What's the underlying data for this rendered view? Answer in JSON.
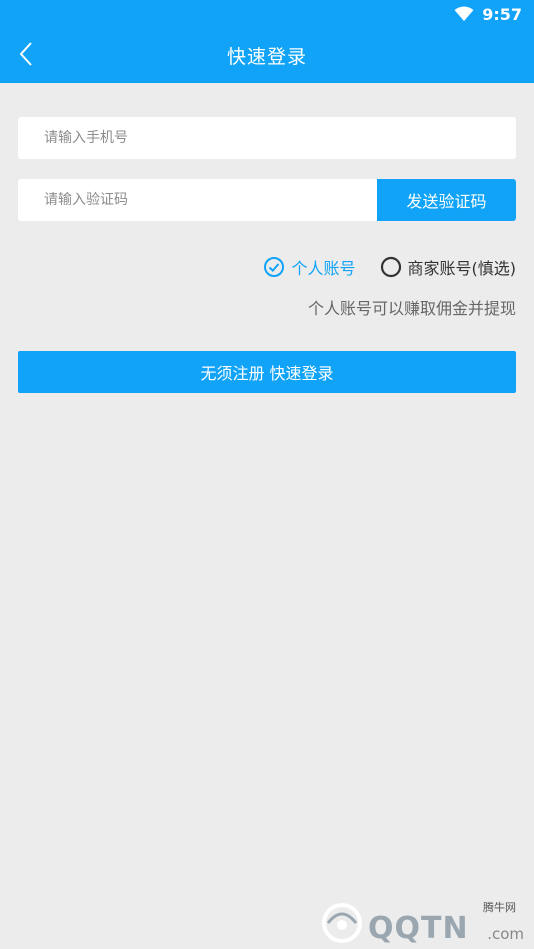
{
  "status_bar": {
    "time": "9:57",
    "wifi_icon": "wifi-icon"
  },
  "header": {
    "title": "快速登录",
    "back_icon": "chevron-left-icon"
  },
  "form": {
    "phone_placeholder": "请输入手机号",
    "code_placeholder": "请输入验证码",
    "send_code_label": "发送验证码"
  },
  "account_type": {
    "personal_label": "个人账号",
    "merchant_label": "商家账号(慎选)",
    "selected": "personal"
  },
  "hint": "个人账号可以赚取佣金并提现",
  "login_button": "无须注册 快速登录",
  "watermark": {
    "text": "QQTN",
    "suffix": ".com",
    "site": "腾牛网"
  },
  "colors": {
    "accent": "#10a3f7",
    "background": "#ececec"
  }
}
